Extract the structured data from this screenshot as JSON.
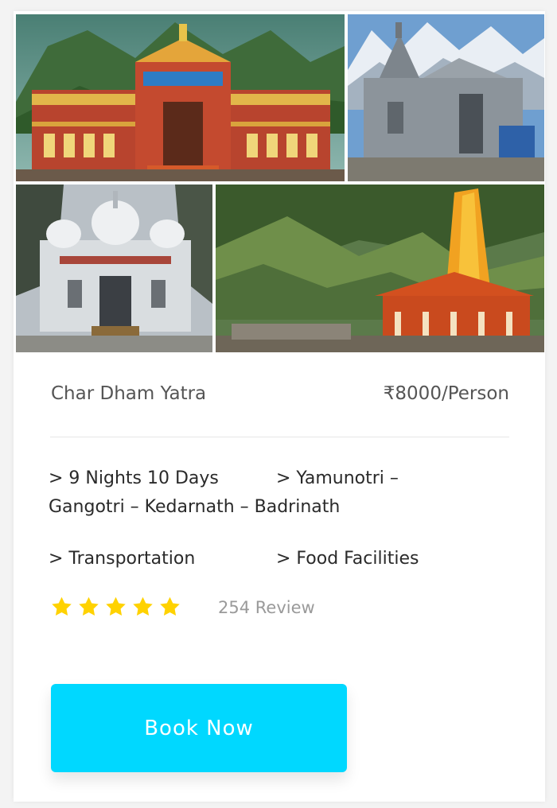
{
  "card": {
    "title": "Char Dham Yatra",
    "price": "₹8000/Person"
  },
  "features": {
    "duration": "> 9 Nights 10 Days",
    "route_part1": "> Yamunotri –",
    "route_part2": "Gangotri – Kedarnath – Badrinath",
    "transport": "> Transportation",
    "food": "> Food Facilities"
  },
  "rating": {
    "stars": 5,
    "reviews_text": "254 Review",
    "star_color": "#ffd200"
  },
  "cta": {
    "label": "Book Now",
    "color": "#00d8ff"
  },
  "photos": [
    {
      "icon": "badrinath-temple-photo"
    },
    {
      "icon": "kedarnath-temple-photo"
    },
    {
      "icon": "gangotri-temple-photo"
    },
    {
      "icon": "yamunotri-temple-photo"
    }
  ]
}
